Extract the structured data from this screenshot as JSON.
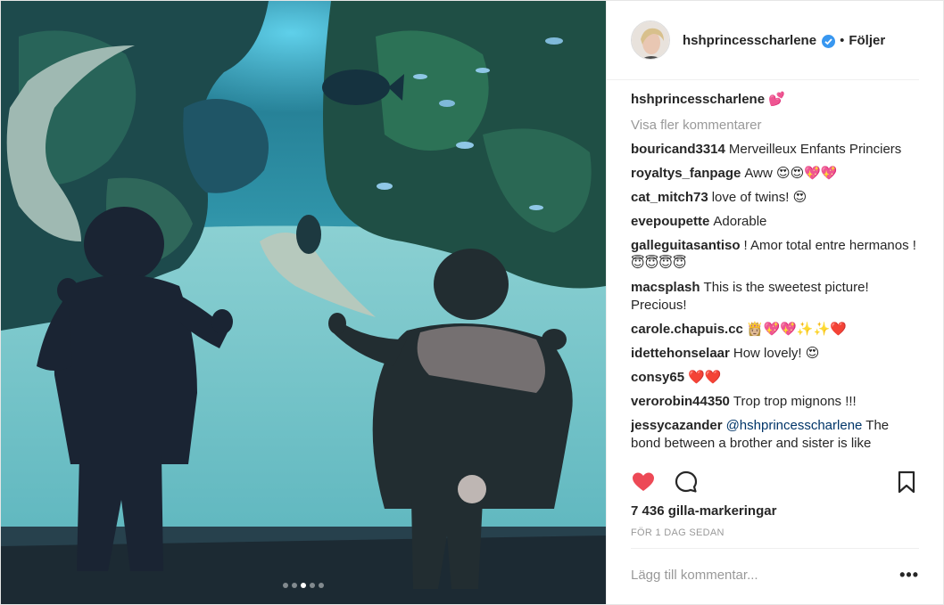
{
  "header": {
    "username": "hshprincesscharlene",
    "verified_icon": "verified-badge-icon",
    "separator": "•",
    "follow_label": "Följer"
  },
  "caption": {
    "username": "hshprincesscharlene",
    "text": "💕"
  },
  "view_more_label": "Visa fler kommentarer",
  "comments": [
    {
      "username": "bouricand3314",
      "text": "Merveilleux Enfants Princiers"
    },
    {
      "username": "royaltys_fanpage",
      "text": "Aww 😍😍💖💖"
    },
    {
      "username": "cat_mitch73",
      "text": "love of twins! 😍"
    },
    {
      "username": "evepoupette",
      "text": "Adorable"
    },
    {
      "username": "galleguitasantiso",
      "text": "! Amor total entre hermanos ! 😇😇😇😇"
    },
    {
      "username": "macsplash",
      "text": "This is the sweetest picture! Precious!"
    },
    {
      "username": "carole.chapuis.cc",
      "text": "👸🏼💖💖✨✨❤️"
    },
    {
      "username": "idettehonselaar",
      "text": "How lovely! 😍"
    },
    {
      "username": "consy65",
      "text": "❤️❤️"
    },
    {
      "username": "verorobin44350",
      "text": "Trop trop mignons !!!"
    },
    {
      "username": "jessycazander",
      "mention": "@hshprincesscharlene",
      "text": "The bond between a brother and sister is like"
    }
  ],
  "actions": {
    "like_icon": "heart-filled-icon",
    "comment_icon": "speech-bubble-icon",
    "save_icon": "bookmark-icon",
    "like_color": "#ed4956"
  },
  "likes_label": "7 436 gilla-markeringar",
  "timestamp": "FÖR 1 DAG SEDAN",
  "add_comment": {
    "placeholder": "Lägg till kommentar...",
    "more_label": "•••"
  },
  "carousel": {
    "count": 5,
    "active_index": 2
  }
}
